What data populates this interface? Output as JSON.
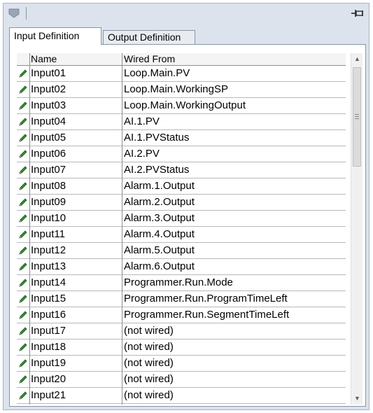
{
  "tabs": [
    {
      "label": "Input Definition"
    },
    {
      "label": "Output Definition"
    }
  ],
  "table": {
    "columns": [
      "Name",
      "Wired From"
    ],
    "rows": [
      {
        "name": "Input01",
        "wired": "Loop.Main.PV"
      },
      {
        "name": "Input02",
        "wired": "Loop.Main.WorkingSP"
      },
      {
        "name": "Input03",
        "wired": "Loop.Main.WorkingOutput"
      },
      {
        "name": "Input04",
        "wired": "AI.1.PV"
      },
      {
        "name": "Input05",
        "wired": "AI.1.PVStatus"
      },
      {
        "name": "Input06",
        "wired": "AI.2.PV"
      },
      {
        "name": "Input07",
        "wired": "AI.2.PVStatus"
      },
      {
        "name": "Input08",
        "wired": "Alarm.1.Output"
      },
      {
        "name": "Input09",
        "wired": "Alarm.2.Output"
      },
      {
        "name": "Input10",
        "wired": "Alarm.3.Output"
      },
      {
        "name": "Input11",
        "wired": "Alarm.4.Output"
      },
      {
        "name": "Input12",
        "wired": "Alarm.5.Output"
      },
      {
        "name": "Input13",
        "wired": "Alarm.6.Output"
      },
      {
        "name": "Input14",
        "wired": "Programmer.Run.Mode"
      },
      {
        "name": "Input15",
        "wired": "Programmer.Run.ProgramTimeLeft"
      },
      {
        "name": "Input16",
        "wired": "Programmer.Run.SegmentTimeLeft"
      },
      {
        "name": "Input17",
        "wired": "(not wired)"
      },
      {
        "name": "Input18",
        "wired": "(not wired)"
      },
      {
        "name": "Input19",
        "wired": "(not wired)"
      },
      {
        "name": "Input20",
        "wired": "(not wired)"
      },
      {
        "name": "Input21",
        "wired": "(not wired)"
      }
    ]
  },
  "icons": {
    "toolbar": "shield-icon",
    "pin": "pin-icon",
    "row": "pencil-icon"
  },
  "colors": {
    "panel_bg": "#dce3ec",
    "pencil_green": "#2f8f2f"
  }
}
